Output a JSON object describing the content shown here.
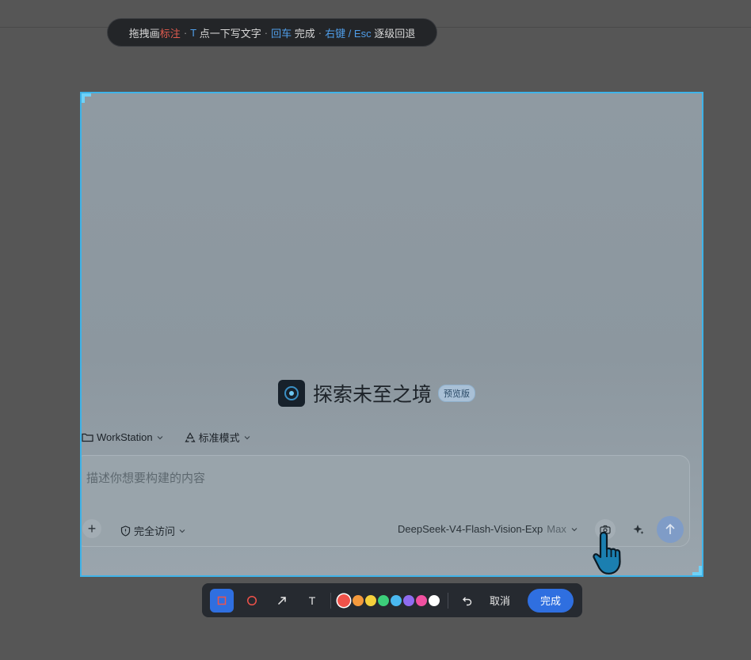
{
  "hint": {
    "seg1": "拖拽画",
    "seg2": "标注",
    "sep1": "·",
    "seg3": "T",
    "seg4": " 点一下写文字",
    "sep2": "·",
    "seg5": "回车",
    "seg6": " 完成",
    "sep3": "·",
    "seg7": "右键 / Esc",
    "seg8": " 逐级回退"
  },
  "hero": {
    "title": "探索未至之境",
    "badge": "预览版"
  },
  "toprow": {
    "workspace": "WorkStation",
    "mode": "标准模式"
  },
  "composer": {
    "placeholder": "描述你想要构建的内容",
    "access": "完全访问",
    "model": "DeepSeek-V4-Flash-Vision-Exp",
    "tier": "Max"
  },
  "toolbar": {
    "text_tool": "T",
    "cancel": "取消",
    "done": "完成",
    "colors": [
      "#f0524a",
      "#f59a3c",
      "#f5d03c",
      "#3ccf7a",
      "#4ab8f0",
      "#8f6cf0",
      "#f050a0",
      "#ffffff"
    ],
    "selected_color": "#f0524a"
  },
  "icons": [
    "folder-icon",
    "chevron-down-icon",
    "recycle-icon",
    "shield-icon",
    "camera-icon",
    "sparkle-icon",
    "arrow-up-icon",
    "hand-cursor-icon",
    "rectangle-icon",
    "circle-icon",
    "arrow-icon",
    "undo-icon"
  ]
}
